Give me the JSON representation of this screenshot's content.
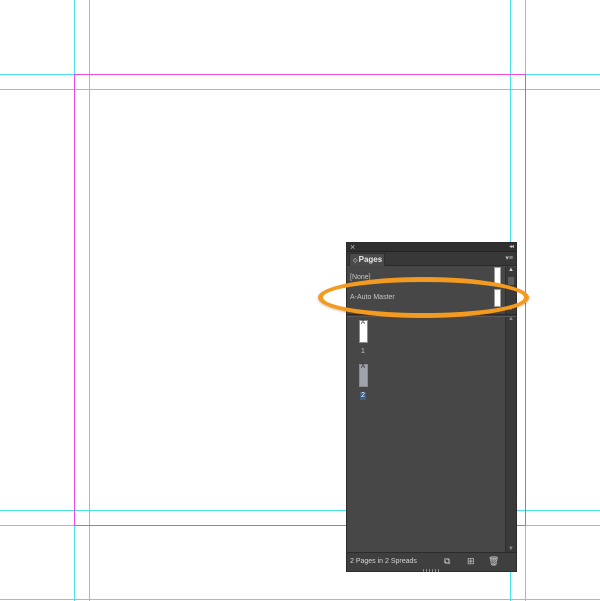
{
  "panel": {
    "close_icon": "×",
    "collapse_icon": "◂◂",
    "tab_arrow": "◇",
    "tab_label": "Pages",
    "menu_icon": "▾≡"
  },
  "masters": {
    "items": [
      {
        "label": "[None]"
      },
      {
        "label": "A-Auto Master"
      }
    ]
  },
  "pages": {
    "items": [
      {
        "master_prefix": "A",
        "number": "1",
        "selected": false
      },
      {
        "master_prefix": "A",
        "number": "2",
        "selected": true
      }
    ]
  },
  "footer": {
    "status": "2 Pages in 2 Spreads",
    "page_size_icon": "⧉",
    "new_page_icon": "⊞",
    "delete_icon": "🗑"
  },
  "scroll": {
    "up": "▲",
    "down": "▼"
  },
  "colors": {
    "guide_cyan": "#4ce0ec",
    "margin_magenta": "#e94be0",
    "panel_bg": "#464646",
    "highlight_orange": "#f39a21",
    "selected_page": "#3e5f87"
  }
}
